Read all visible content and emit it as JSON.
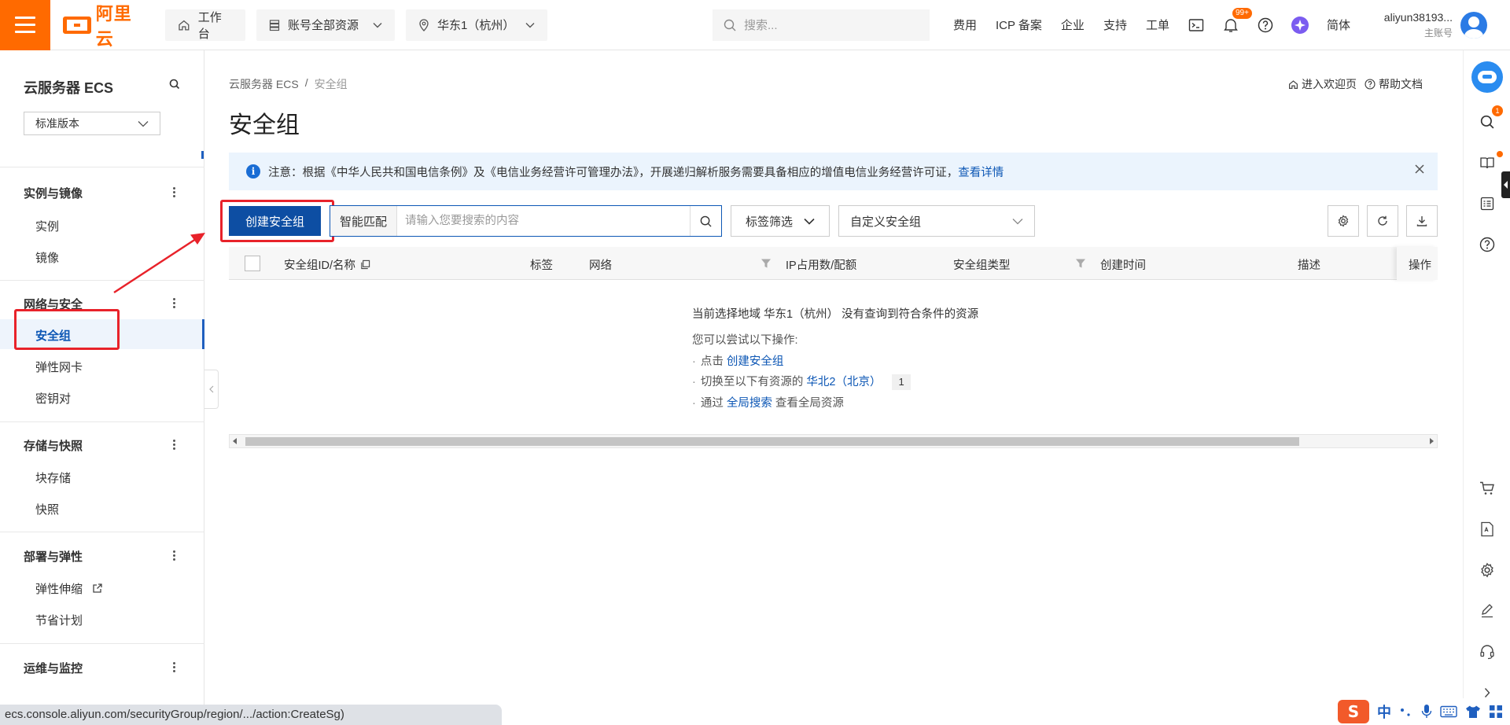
{
  "topbar": {
    "logo_text": "阿里云",
    "workbench": "工作台",
    "resources": "账号全部资源",
    "region": "华东1（杭州）",
    "search_placeholder": "搜索...",
    "links": [
      "费用",
      "ICP 备案",
      "企业",
      "支持",
      "工单"
    ],
    "notification_badge": "99+",
    "language": "简体",
    "account_name": "aliyun38193...",
    "account_role": "主账号",
    "brand_color": "#ff6a00"
  },
  "sidebar": {
    "title": "云服务器 ECS",
    "version_select": "标准版本",
    "groups": [
      {
        "label": "实例与镜像",
        "items": [
          "实例",
          "镜像"
        ]
      },
      {
        "label": "网络与安全",
        "items": [
          "安全组",
          "弹性网卡",
          "密钥对"
        ]
      },
      {
        "label": "存储与快照",
        "items": [
          "块存储",
          "快照"
        ]
      },
      {
        "label": "部署与弹性",
        "items": [
          "弹性伸缩",
          "节省计划"
        ]
      },
      {
        "label": "运维与监控",
        "items": []
      }
    ],
    "active_item": "安全组"
  },
  "main": {
    "breadcrumb": [
      "云服务器 ECS",
      "安全组"
    ],
    "breadcrumb_sep": "/",
    "welcome_link": "进入欢迎页",
    "help_link": "帮助文档",
    "title": "安全组",
    "notice": {
      "text": "注意：根据《中华人民共和国电信条例》及《电信业务经营许可管理办法》，开展递归解析服务需要具备相应的增值电信业务经营许可证，",
      "link": "查看详情"
    },
    "toolbar": {
      "create_label": "创建安全组",
      "search_mode": "智能匹配",
      "search_placeholder": "请输入您要搜索的内容",
      "tag_filter": "标签筛选",
      "custom_select": "自定义安全组"
    },
    "table": {
      "columns": [
        "安全组ID/名称",
        "标签",
        "网络",
        "IP占用数/配额",
        "安全组类型",
        "创建时间",
        "描述",
        "操作"
      ]
    },
    "empty": {
      "headline": "当前选择地域 华东1（杭州） 没有查询到符合条件的资源",
      "try_text": "您可以尝试以下操作:",
      "opt1_prefix": "点击",
      "opt1_link": "创建安全组",
      "opt2_prefix": "切换至以下有资源的",
      "opt2_link": "华北2（北京）",
      "opt2_count": "1",
      "opt3_prefix": "通过",
      "opt3_link": "全局搜索",
      "opt3_suffix": "查看全局资源"
    }
  },
  "statusbar": {
    "url": "ecs.console.aliyun.com/securityGroup/region/.../action:CreateSg)"
  },
  "ime": {
    "logo": "S",
    "mode": "中"
  },
  "rail": {
    "search_badge": "1"
  }
}
